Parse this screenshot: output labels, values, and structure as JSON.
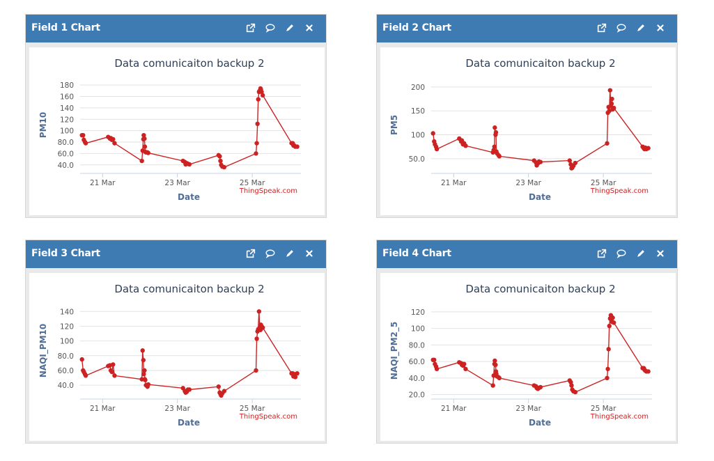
{
  "header_icons": [
    "external-link-icon",
    "comment-icon",
    "pencil-icon",
    "close-icon"
  ],
  "colors": {
    "header": "#3f7bb3",
    "series": "#cc2222",
    "credit": "#cc2222",
    "axis_title": "#4f6d96",
    "title": "#2d3e55"
  },
  "charts": [
    {
      "panel_title": "Field 1 Chart",
      "chart_data": {
        "type": "line",
        "title": "Data comunicaiton backup 2",
        "xlabel": "Date",
        "ylabel": "PM10",
        "x_range_days": [
          20.4,
          26.3
        ],
        "x_ticks": [
          21,
          23,
          25
        ],
        "x_tick_labels": [
          "21 Mar",
          "23 Mar",
          "25 Mar"
        ],
        "ylim": [
          30,
          185
        ],
        "y_ticks": [
          40,
          60,
          80,
          100,
          120,
          140,
          160,
          180
        ],
        "y_tick_labels": [
          "40.0",
          "60.0",
          "80.0",
          "100",
          "120",
          "140",
          "160",
          "180"
        ],
        "credit": "ThingSpeak.com",
        "x_days": [
          20.45,
          20.48,
          20.5,
          20.53,
          20.55,
          21.15,
          21.2,
          21.22,
          21.25,
          21.28,
          21.32,
          22.05,
          22.07,
          22.09,
          22.1,
          22.12,
          22.13,
          22.14,
          22.16,
          22.2,
          22.22,
          23.15,
          23.2,
          23.22,
          23.25,
          23.28,
          23.32,
          24.1,
          24.13,
          24.15,
          24.17,
          24.2,
          24.25,
          25.1,
          25.12,
          25.14,
          25.16,
          25.18,
          25.2,
          25.22,
          25.23,
          25.25,
          25.28,
          26.05,
          26.08,
          26.1,
          26.12,
          26.15,
          26.2
        ],
        "y": [
          92,
          92,
          84,
          80,
          78,
          89,
          86,
          87,
          84,
          85,
          78,
          47,
          65,
          85,
          92,
          86,
          72,
          63,
          62,
          62,
          61,
          47,
          45,
          41,
          43,
          42,
          41,
          57,
          55,
          47,
          40,
          37,
          36,
          60,
          78,
          112,
          155,
          168,
          170,
          174,
          172,
          168,
          162,
          78,
          78,
          74,
          74,
          72,
          72
        ]
      }
    },
    {
      "panel_title": "Field 2 Chart",
      "chart_data": {
        "type": "line",
        "title": "Data comunicaiton backup 2",
        "xlabel": "Date",
        "ylabel": "PM5",
        "x_range_days": [
          20.4,
          26.3
        ],
        "x_ticks": [
          21,
          23,
          25
        ],
        "x_tick_labels": [
          "21 Mar",
          "23 Mar",
          "25 Mar"
        ],
        "ylim": [
          25,
          210
        ],
        "y_ticks": [
          50,
          100,
          150,
          200
        ],
        "y_tick_labels": [
          "50.0",
          "100",
          "150",
          "200"
        ],
        "credit": "ThingSpeak.com",
        "x_days": [
          20.45,
          20.48,
          20.5,
          20.53,
          20.55,
          21.15,
          21.2,
          21.22,
          21.25,
          21.28,
          21.32,
          22.05,
          22.07,
          22.09,
          22.1,
          22.12,
          22.13,
          22.14,
          22.16,
          22.2,
          22.22,
          23.15,
          23.2,
          23.22,
          23.25,
          23.28,
          23.32,
          24.1,
          24.13,
          24.15,
          24.17,
          24.2,
          24.25,
          25.1,
          25.12,
          25.14,
          25.16,
          25.18,
          25.2,
          25.22,
          25.23,
          25.25,
          25.28,
          26.05,
          26.08,
          26.1,
          26.12,
          26.15,
          26.2
        ],
        "y": [
          103,
          86,
          80,
          75,
          70,
          92,
          86,
          88,
          80,
          82,
          77,
          63,
          68,
          75,
          115,
          100,
          105,
          65,
          61,
          57,
          55,
          46,
          42,
          36,
          40,
          44,
          43,
          46,
          38,
          30,
          31,
          35,
          41,
          82,
          146,
          158,
          150,
          193,
          160,
          165,
          175,
          153,
          156,
          75,
          72,
          70,
          73,
          70,
          72
        ]
      }
    },
    {
      "panel_title": "Field 3 Chart",
      "chart_data": {
        "type": "line",
        "title": "Data comunicaiton backup 2",
        "xlabel": "Date",
        "ylabel": "NAQI_PM10",
        "x_range_days": [
          20.4,
          26.3
        ],
        "x_ticks": [
          21,
          23,
          25
        ],
        "x_tick_labels": [
          "21 Mar",
          "23 Mar",
          "25 Mar"
        ],
        "ylim": [
          25,
          145
        ],
        "y_ticks": [
          40,
          60,
          80,
          100,
          120,
          140
        ],
        "y_tick_labels": [
          "40.0",
          "60.0",
          "80.0",
          "100",
          "120",
          "140"
        ],
        "credit": "ThingSpeak.com",
        "x_days": [
          20.45,
          20.48,
          20.5,
          20.53,
          20.55,
          21.15,
          21.2,
          21.22,
          21.25,
          21.28,
          21.32,
          22.05,
          22.07,
          22.09,
          22.1,
          22.12,
          22.13,
          22.14,
          22.16,
          22.2,
          22.22,
          23.15,
          23.2,
          23.22,
          23.25,
          23.28,
          23.32,
          24.1,
          24.13,
          24.15,
          24.17,
          24.2,
          24.25,
          25.1,
          25.12,
          25.14,
          25.16,
          25.18,
          25.2,
          25.22,
          25.23,
          25.25,
          25.28,
          26.05,
          26.08,
          26.1,
          26.12,
          26.15,
          26.2
        ],
        "y": [
          75,
          60,
          58,
          55,
          53,
          66,
          67,
          60,
          58,
          68,
          53,
          48,
          87,
          74,
          55,
          60,
          48,
          47,
          40,
          38,
          41,
          36,
          32,
          30,
          31,
          34,
          34,
          38,
          30,
          28,
          26,
          29,
          32,
          60,
          103,
          113,
          116,
          140,
          118,
          115,
          122,
          120,
          118,
          56,
          56,
          52,
          55,
          51,
          56
        ]
      }
    },
    {
      "panel_title": "Field 4 Chart",
      "chart_data": {
        "type": "line",
        "title": "Data comunicaiton backup 2",
        "xlabel": "Date",
        "ylabel": "NAQI_PM2_5",
        "x_range_days": [
          20.4,
          26.3
        ],
        "x_ticks": [
          21,
          23,
          25
        ],
        "x_tick_labels": [
          "21 Mar",
          "23 Mar",
          "25 Mar"
        ],
        "ylim": [
          18,
          125
        ],
        "y_ticks": [
          20,
          40,
          60,
          80,
          100,
          120
        ],
        "y_tick_labels": [
          "20.0",
          "40.0",
          "60.0",
          "80.0",
          "100",
          "120"
        ],
        "credit": "ThingSpeak.com",
        "x_days": [
          20.45,
          20.48,
          20.5,
          20.53,
          20.55,
          21.15,
          21.2,
          21.22,
          21.25,
          21.28,
          21.32,
          22.05,
          22.07,
          22.09,
          22.1,
          22.12,
          22.13,
          22.14,
          22.16,
          22.2,
          22.22,
          23.15,
          23.2,
          23.22,
          23.25,
          23.28,
          23.32,
          24.1,
          24.13,
          24.15,
          24.17,
          24.2,
          24.25,
          25.1,
          25.12,
          25.14,
          25.16,
          25.18,
          25.2,
          25.22,
          25.23,
          25.25,
          25.28,
          26.05,
          26.08,
          26.1,
          26.12,
          26.15,
          26.2
        ],
        "y": [
          62,
          62,
          57,
          54,
          51,
          59,
          58,
          56,
          55,
          57,
          51,
          31,
          43,
          57,
          61,
          56,
          48,
          45,
          42,
          41,
          40,
          31,
          30,
          28,
          27,
          28,
          29,
          37,
          35,
          31,
          26,
          24,
          23,
          40,
          51,
          75,
          103,
          112,
          116,
          114,
          108,
          113,
          107,
          52,
          52,
          50,
          49,
          48,
          48
        ]
      }
    }
  ]
}
